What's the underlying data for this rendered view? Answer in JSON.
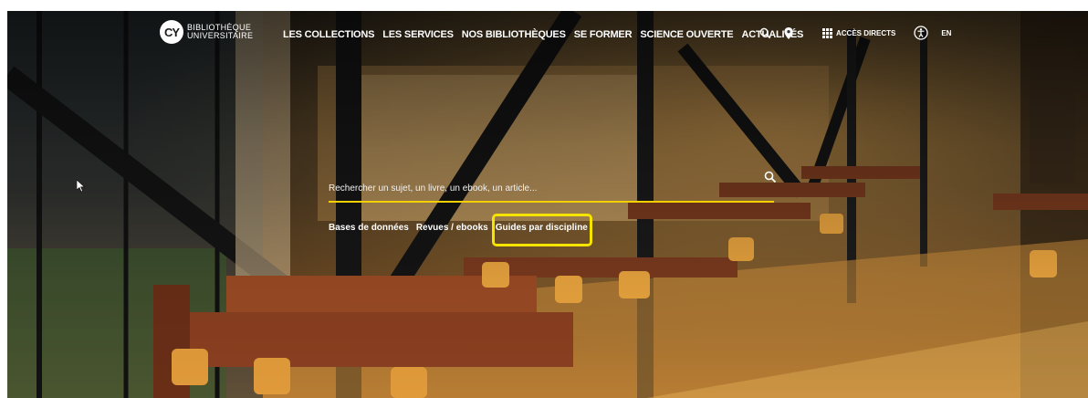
{
  "logo": {
    "mark": "CY",
    "line1": "BIBLIOTHÈQUE",
    "line2": "UNIVERSITAIRE"
  },
  "nav": {
    "items": [
      {
        "label": "LES COLLECTIONS"
      },
      {
        "label": "LES SERVICES"
      },
      {
        "label": "NOS BIBLIOTHÈQUES"
      },
      {
        "label": "SE FORMER"
      },
      {
        "label": "SCIENCE OUVERTE"
      },
      {
        "label": "ACTUALITÉS"
      }
    ]
  },
  "top_icons": {
    "search_icon": "search-icon",
    "location_icon": "map-pin-icon",
    "direct_access_label": "ACCÈS DIRECTS",
    "accessibility_icon": "accessibility-icon",
    "language": "EN"
  },
  "search": {
    "placeholder": "Rechercher un sujet, un livre, un ebook, un article..."
  },
  "quick_links": [
    {
      "label": "Bases de données"
    },
    {
      "label": "Revues / ebooks"
    },
    {
      "label": "Guides par discipline"
    }
  ],
  "colors": {
    "accent": "#f5d000",
    "highlight": "#f5e400"
  }
}
